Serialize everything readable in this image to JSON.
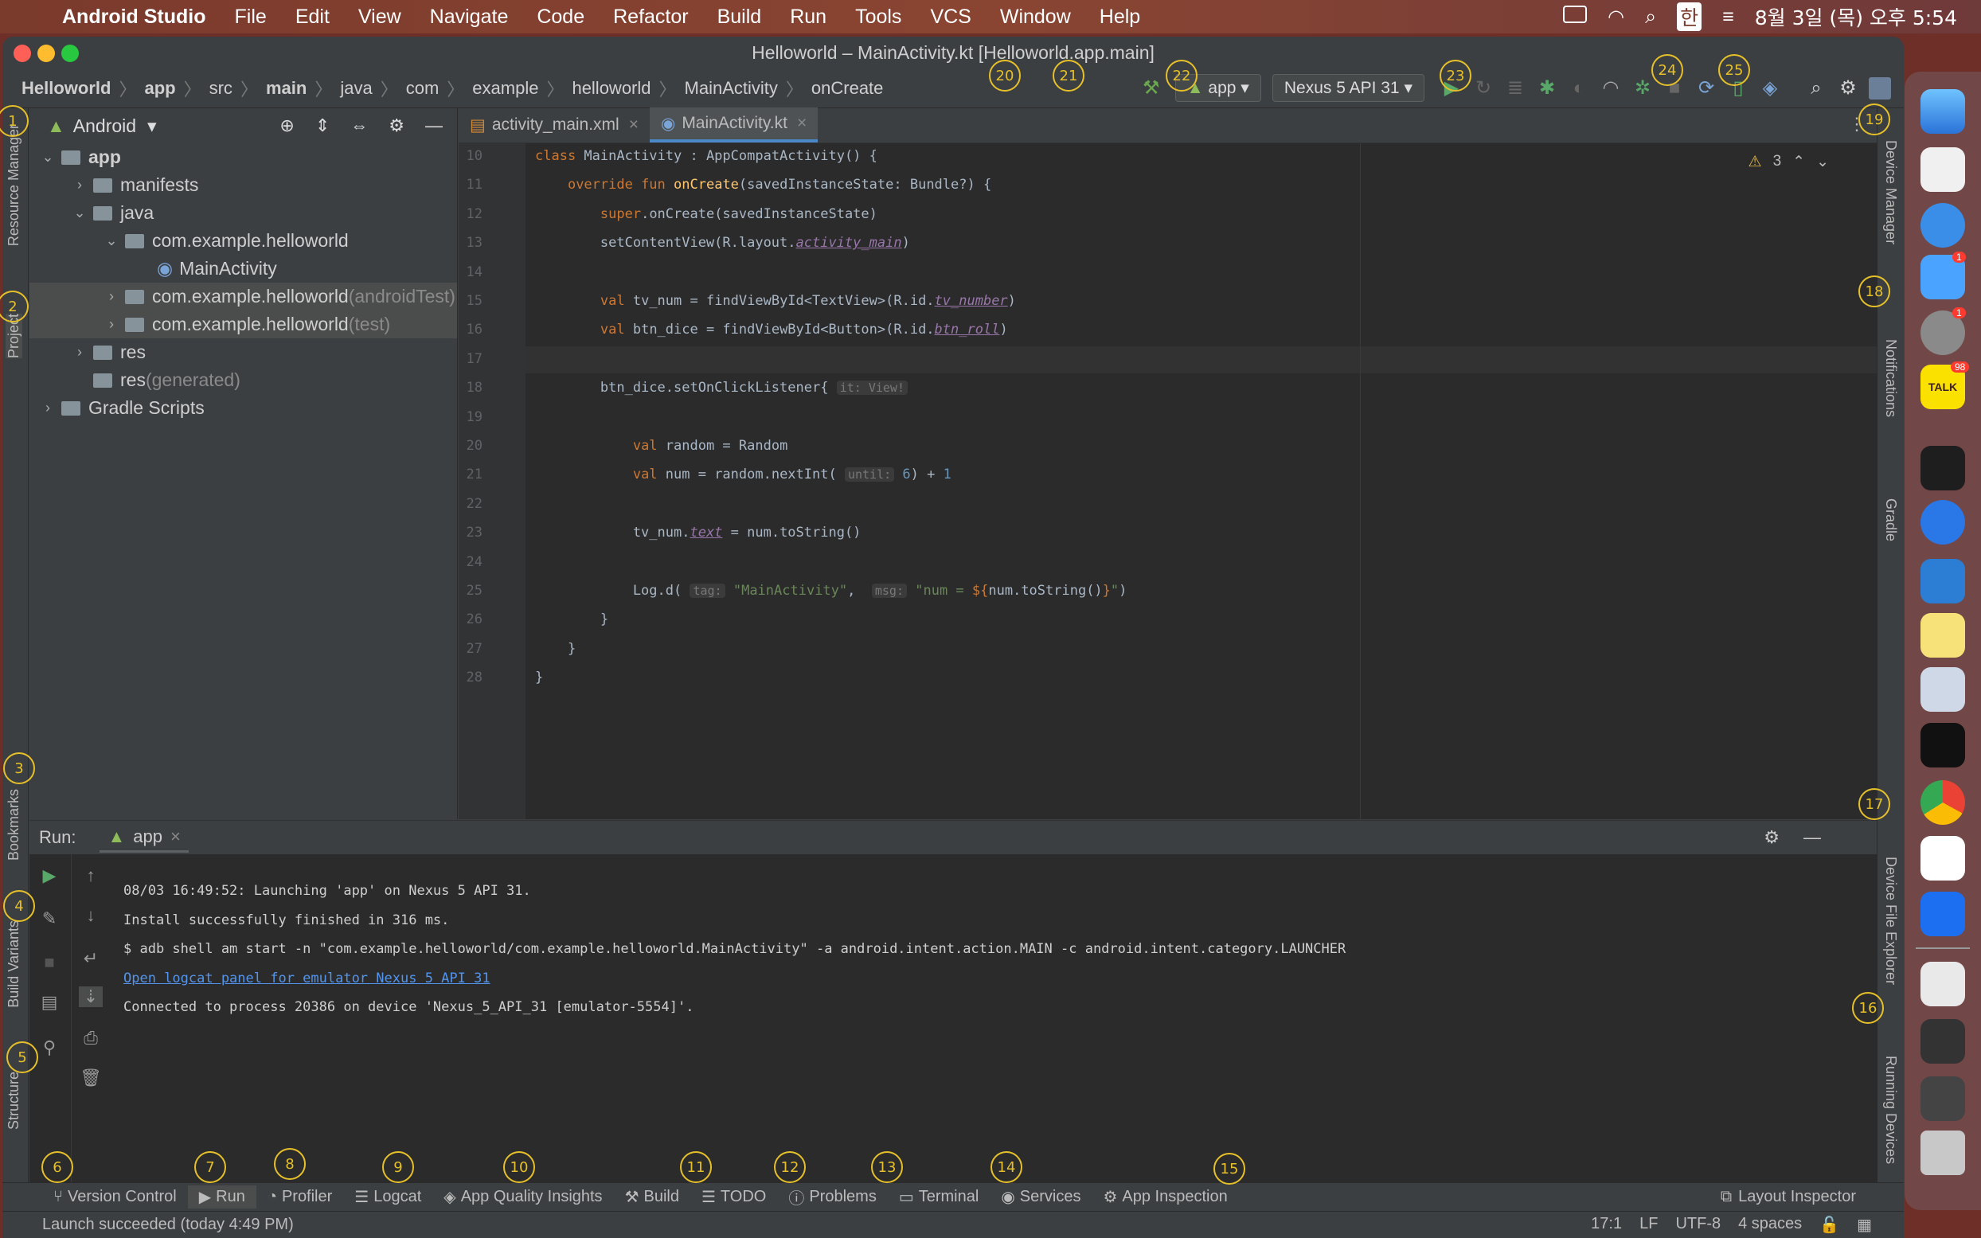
{
  "menubar": {
    "app_name": "Android Studio",
    "items": [
      "File",
      "Edit",
      "View",
      "Navigate",
      "Code",
      "Refactor",
      "Build",
      "Run",
      "Tools",
      "VCS",
      "Window",
      "Help"
    ],
    "datetime": "8월 3일 (목) 오후 5:54",
    "input_lang": "한"
  },
  "window": {
    "title": "Helloworld – MainActivity.kt [Helloworld.app.main]"
  },
  "breadcrumb": [
    "Helloworld",
    "app",
    "src",
    "main",
    "java",
    "com",
    "example",
    "helloworld",
    "MainActivity",
    "onCreate"
  ],
  "toolbar": {
    "run_config": "app",
    "device": "Nexus 5 API 31"
  },
  "project": {
    "view_mode": "Android",
    "tree": [
      {
        "label": "app",
        "indent": 0,
        "expand": "v",
        "bold": true
      },
      {
        "label": "manifests",
        "indent": 1,
        "expand": ">"
      },
      {
        "label": "java",
        "indent": 1,
        "expand": "v"
      },
      {
        "label": "com.example.helloworld",
        "indent": 2,
        "expand": "v"
      },
      {
        "label": "MainActivity",
        "indent": 3,
        "expand": ""
      },
      {
        "label": "com.example.helloworld",
        "suffix": "(androidTest)",
        "indent": 2,
        "expand": ">",
        "sel": true
      },
      {
        "label": "com.example.helloworld",
        "suffix": "(test)",
        "indent": 2,
        "expand": ">",
        "sel": true
      },
      {
        "label": "res",
        "indent": 1,
        "expand": ">"
      },
      {
        "label": "res",
        "suffix": "(generated)",
        "indent": 1,
        "expand": ""
      },
      {
        "label": "Gradle Scripts",
        "indent": 0,
        "expand": ">"
      }
    ]
  },
  "editor": {
    "tabs": [
      "activity_main.xml",
      "MainActivity.kt"
    ],
    "active_tab": "MainActivity.kt",
    "warnings": "3",
    "lines": [
      {
        "n": "10",
        "html": "<span class='kw'>class</span> MainActivity : AppCompatActivity() {"
      },
      {
        "n": "11",
        "html": "    <span class='kw'>override fun</span> <span class='fn'>onCreate</span>(savedInstanceState: Bundle?) {"
      },
      {
        "n": "12",
        "html": "        <span class='kw'>super</span>.onCreate(savedInstanceState)"
      },
      {
        "n": "13",
        "html": "        setContentView(R.layout.<span class='it'>activity_main</span>)"
      },
      {
        "n": "14",
        "html": ""
      },
      {
        "n": "15",
        "html": "        <span class='kw'>val</span> tv_num = findViewById&lt;TextView&gt;(R.id.<span class='it'>tv_number</span>)"
      },
      {
        "n": "16",
        "html": "        <span class='kw'>val</span> btn_dice = findViewById&lt;Button&gt;(R.id.<span class='it'>btn_roll</span>)"
      },
      {
        "n": "17",
        "html": ""
      },
      {
        "n": "18",
        "html": "        btn_dice.setOnClickListener{ <span class='hint'>it: View!</span>"
      },
      {
        "n": "19",
        "html": ""
      },
      {
        "n": "20",
        "html": "            <span class='kw'>val</span> random = Random"
      },
      {
        "n": "21",
        "html": "            <span class='kw'>val</span> num = random.nextInt( <span class='hint'>until:</span> <span class='num'>6</span>) + <span class='num'>1</span>"
      },
      {
        "n": "22",
        "html": ""
      },
      {
        "n": "23",
        "html": "            tv_num.<span class='it'>text</span> = num.toString()"
      },
      {
        "n": "24",
        "html": ""
      },
      {
        "n": "25",
        "html": "            Log.d( <span class='hint'>tag:</span> <span class='str'>\"MainActivity\"</span>,  <span class='hint'>msg:</span> <span class='str'>\"num = </span><span class='kw'>${</span>num.toString()<span class='kw'>}</span><span class='str'>\"</span>)"
      },
      {
        "n": "26",
        "html": "        }"
      },
      {
        "n": "27",
        "html": "    }"
      },
      {
        "n": "28",
        "html": "}"
      }
    ]
  },
  "run": {
    "label": "Run:",
    "tab": "app",
    "console": [
      {
        "text": "08/03 16:49:52: Launching 'app' on Nexus 5 API 31.",
        "link": false
      },
      {
        "text": "Install successfully finished in 316 ms.",
        "link": false
      },
      {
        "text": "$ adb shell am start -n \"com.example.helloworld/com.example.helloworld.MainActivity\" -a android.intent.action.MAIN -c android.intent.category.LAUNCHER",
        "link": false
      },
      {
        "text": "Open logcat panel for emulator Nexus 5 API 31",
        "link": true
      },
      {
        "text": "Connected to process 20386 on device 'Nexus_5_API_31 [emulator-5554]'.",
        "link": false
      }
    ]
  },
  "left_tools": [
    "Resource Manager",
    "Project",
    "Bookmarks",
    "Build Variants",
    "Structure"
  ],
  "right_tools": [
    "Device Manager",
    "Notifications",
    "Gradle",
    "Device File Explorer",
    "Running Devices"
  ],
  "bottom_tools": [
    "Version Control",
    "Run",
    "Profiler",
    "Logcat",
    "App Quality Insights",
    "Build",
    "TODO",
    "Problems",
    "Terminal",
    "Services",
    "App Inspection"
  ],
  "layout_inspector": "Layout Inspector",
  "status": {
    "message": "Launch succeeded (today 4:49 PM)",
    "position": "17:1",
    "line_sep": "LF",
    "encoding": "UTF-8",
    "indent": "4 spaces"
  },
  "annotations": [
    "1",
    "2",
    "3",
    "4",
    "5",
    "6",
    "7",
    "8",
    "9",
    "10",
    "11",
    "12",
    "13",
    "14",
    "15",
    "16",
    "17",
    "18",
    "19",
    "20",
    "21",
    "22",
    "23",
    "24",
    "25"
  ],
  "dock_badges": {
    "mail": "1",
    "settings": "1",
    "talk": "98"
  },
  "colors": {
    "accent": "#4a88c7",
    "annotation": "#e6c02a",
    "keyword": "#cc7832",
    "string": "#6a8759"
  }
}
